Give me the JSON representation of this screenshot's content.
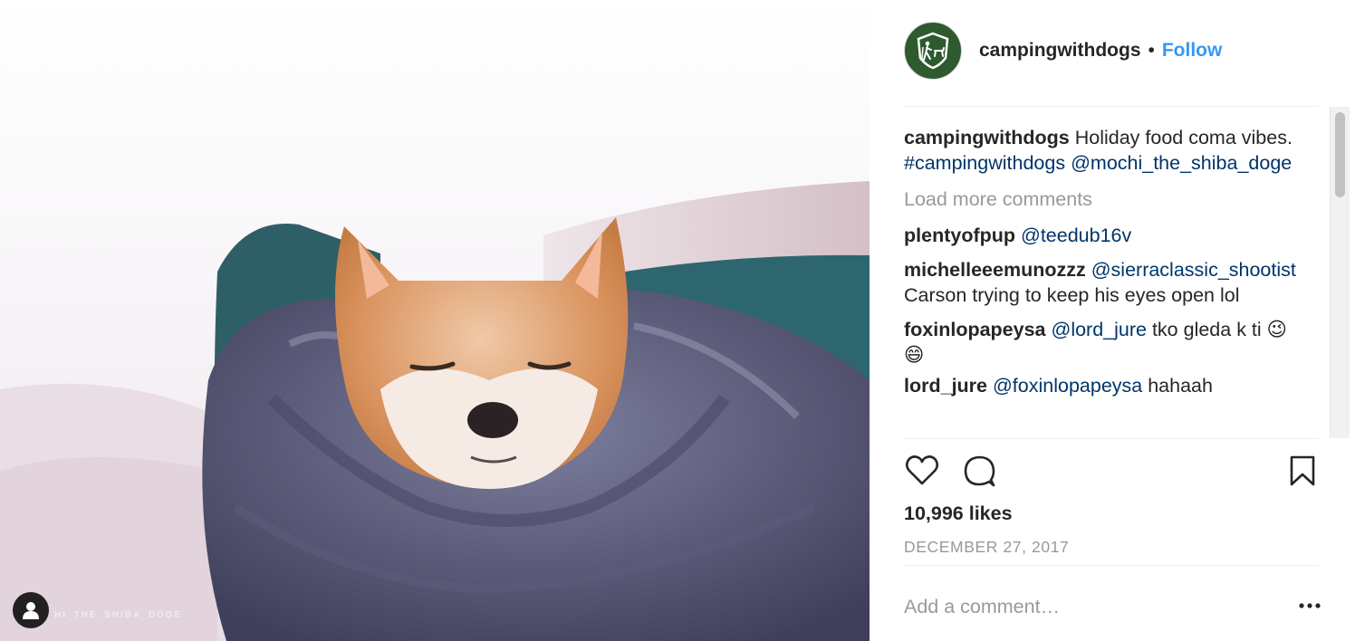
{
  "post": {
    "photo_watermark": "HI_THE_SHIBA_DOGE",
    "photo_alt_icon": "user-tag-icon"
  },
  "header": {
    "username": "campingwithdogs",
    "separator": "•",
    "follow_label": "Follow",
    "avatar_icon": "hiker-with-dogs-logo"
  },
  "caption": {
    "username": "campingwithdogs",
    "text": " Holiday food coma vibes. ",
    "hashtag": "#campingwithdogs",
    "mention": "@mochi_the_shiba_doge"
  },
  "load_more": "Load more comments",
  "comments": [
    {
      "user": "plentyofpup",
      "mention": "@teedub16v",
      "text": ""
    },
    {
      "user": "michelleeemunozzz",
      "mention": "@sierraclassic_shootist",
      "text": " Carson trying to keep his eyes open lol"
    },
    {
      "user": "foxinlopapeysa",
      "mention": "@lord_jure",
      "text": " tko gleda k ti 😉 😄"
    },
    {
      "user": "lord_jure",
      "mention": "@foxinlopapeysa",
      "text": " hahaah"
    }
  ],
  "actions": {
    "like_icon": "heart-icon",
    "comment_icon": "comment-bubble-icon",
    "save_icon": "bookmark-icon"
  },
  "likes": "10,996 likes",
  "date": "DECEMBER 27, 2017",
  "add_comment_placeholder": "Add a comment…",
  "more_icon": "more-options-icon",
  "colors": {
    "follow": "#3897f0",
    "link": "#003569",
    "muted": "#999999",
    "avatar_bg": "#2e5a2f"
  }
}
